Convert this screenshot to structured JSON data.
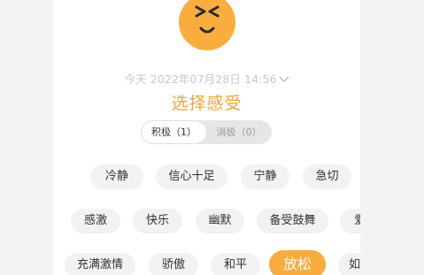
{
  "header": {
    "date_label": "今天 2022年07月28日 14:56",
    "title": "选择感受"
  },
  "toggle": {
    "positive_label": "积极（1）",
    "negative_label": "消极（0）"
  },
  "feelings": {
    "row1": [
      "冷静",
      "信心十足",
      "宁静",
      "急切"
    ],
    "row2": [
      "感激",
      "快乐",
      "幽默",
      "备受鼓舞",
      "爱"
    ],
    "row3": [
      "充满激情",
      "骄傲",
      "和平",
      "放松",
      "如"
    ]
  },
  "selected_feeling": "放松",
  "colors": {
    "accent": "#f9ab3d",
    "title": "#f2a43a",
    "tag_bg": "#f2f2f2",
    "date_text": "#c8c8c8"
  }
}
